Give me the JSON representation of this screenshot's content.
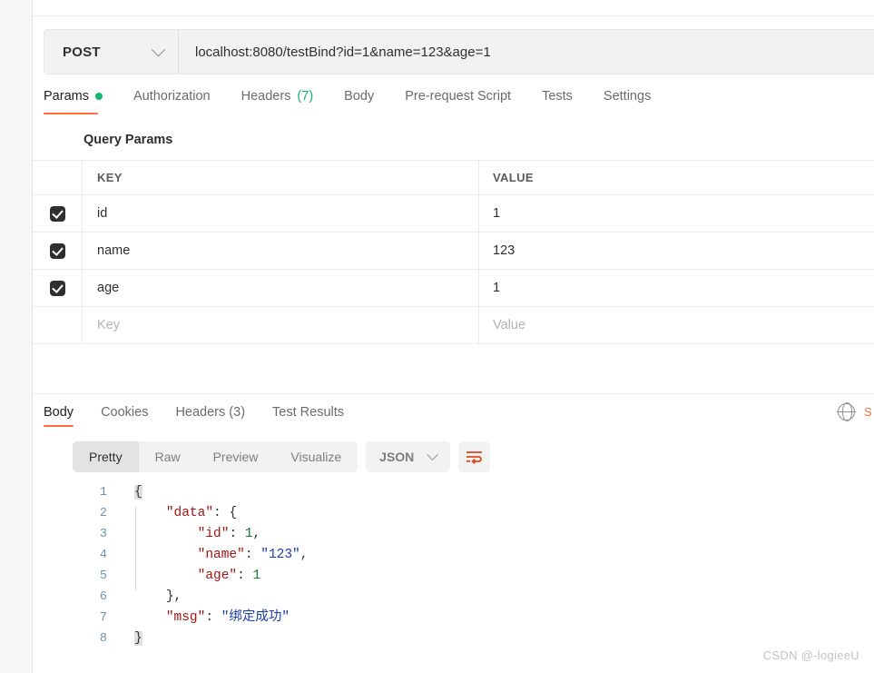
{
  "request": {
    "method": "POST",
    "method_chevron_icon": "chevron-down-icon",
    "url": "localhost:8080/testBind?id=1&name=123&age=1",
    "tabs": [
      {
        "label": "Params",
        "badge": "",
        "dot": true,
        "active": true
      },
      {
        "label": "Authorization",
        "badge": "",
        "dot": false,
        "active": false
      },
      {
        "label": "Headers",
        "badge": "(7)",
        "dot": false,
        "active": false
      },
      {
        "label": "Body",
        "badge": "",
        "dot": false,
        "active": false
      },
      {
        "label": "Pre-request Script",
        "badge": "",
        "dot": false,
        "active": false
      },
      {
        "label": "Tests",
        "badge": "",
        "dot": false,
        "active": false
      },
      {
        "label": "Settings",
        "badge": "",
        "dot": false,
        "active": false
      }
    ],
    "section_title": "Query Params",
    "table": {
      "headers": {
        "key": "KEY",
        "value": "VALUE"
      },
      "rows": [
        {
          "checked": true,
          "key": "id",
          "value": "1"
        },
        {
          "checked": true,
          "key": "name",
          "value": "123"
        },
        {
          "checked": true,
          "key": "age",
          "value": "1"
        }
      ],
      "placeholder_row": {
        "key": "Key",
        "value": "Value"
      }
    }
  },
  "response": {
    "tabs": [
      {
        "label": "Body",
        "badge": "",
        "active": true
      },
      {
        "label": "Cookies",
        "badge": "",
        "active": false
      },
      {
        "label": "Headers",
        "badge": "(3)",
        "active": false
      },
      {
        "label": "Test Results",
        "badge": "",
        "active": false
      }
    ],
    "globe_icon": "globe-icon",
    "clipped_label": "S",
    "format_tabs": [
      {
        "label": "Pretty",
        "active": true
      },
      {
        "label": "Raw",
        "active": false
      },
      {
        "label": "Preview",
        "active": false
      },
      {
        "label": "Visualize",
        "active": false
      }
    ],
    "language": "JSON",
    "language_chevron_icon": "chevron-down-icon",
    "wrap_icon": "word-wrap-icon",
    "body_lines": [
      {
        "num": "1",
        "tokens": [
          {
            "t": "{",
            "c": "br"
          }
        ]
      },
      {
        "num": "2",
        "tokens": [
          {
            "t": "    ",
            "c": "p"
          },
          {
            "t": "\"data\"",
            "c": "k"
          },
          {
            "t": ": ",
            "c": "p"
          },
          {
            "t": "{",
            "c": "p"
          }
        ]
      },
      {
        "num": "3",
        "tokens": [
          {
            "t": "        ",
            "c": "p"
          },
          {
            "t": "\"id\"",
            "c": "k"
          },
          {
            "t": ": ",
            "c": "p"
          },
          {
            "t": "1",
            "c": "n"
          },
          {
            "t": ",",
            "c": "p"
          }
        ]
      },
      {
        "num": "4",
        "tokens": [
          {
            "t": "        ",
            "c": "p"
          },
          {
            "t": "\"name\"",
            "c": "k"
          },
          {
            "t": ": ",
            "c": "p"
          },
          {
            "t": "\"123\"",
            "c": "s"
          },
          {
            "t": ",",
            "c": "p"
          }
        ]
      },
      {
        "num": "5",
        "tokens": [
          {
            "t": "        ",
            "c": "p"
          },
          {
            "t": "\"age\"",
            "c": "k"
          },
          {
            "t": ": ",
            "c": "p"
          },
          {
            "t": "1",
            "c": "n"
          }
        ]
      },
      {
        "num": "6",
        "tokens": [
          {
            "t": "    ",
            "c": "p"
          },
          {
            "t": "}",
            "c": "p"
          },
          {
            "t": ",",
            "c": "p"
          }
        ]
      },
      {
        "num": "7",
        "tokens": [
          {
            "t": "    ",
            "c": "p"
          },
          {
            "t": "\"msg\"",
            "c": "k"
          },
          {
            "t": ": ",
            "c": "p"
          },
          {
            "t": "\"绑定成功\"",
            "c": "s"
          }
        ]
      },
      {
        "num": "8",
        "tokens": [
          {
            "t": "}",
            "c": "br"
          }
        ]
      }
    ],
    "parsed_body": {
      "data": {
        "id": 1,
        "name": "123",
        "age": 1
      },
      "msg": "绑定成功"
    }
  },
  "watermark": "CSDN @-logieeU",
  "colors": {
    "accent_orange": "#ff6c37",
    "status_green": "#12b76a",
    "json_key": "#a31515",
    "json_string": "#1a3ea8",
    "json_number": "#0f7a37",
    "line_number": "#6e93b0"
  }
}
